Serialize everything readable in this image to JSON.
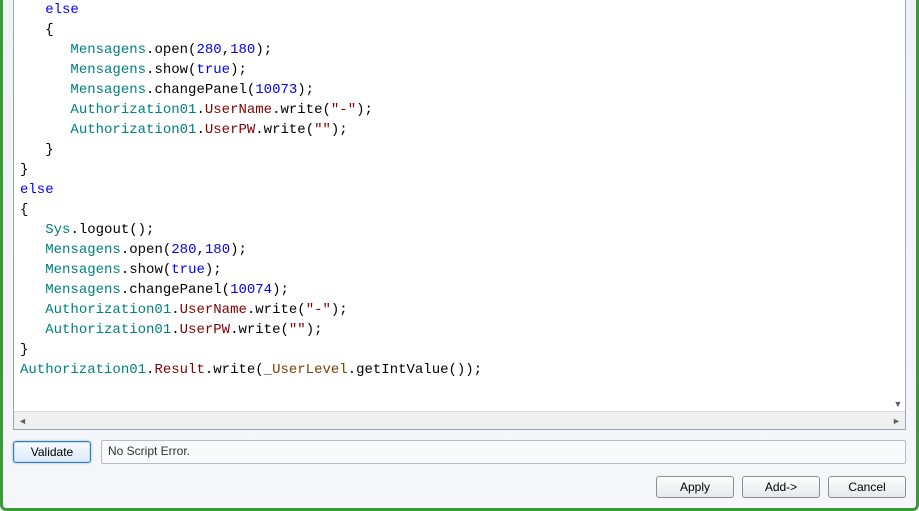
{
  "code": {
    "l01_kw": "else",
    "l02_pun": "{",
    "l03_a": "Mensagens",
    "l03_b": ".open(",
    "l03_c": "280",
    "l03_d": ",",
    "l03_e": "180",
    "l03_f": ");",
    "l04_a": "Mensagens",
    "l04_b": ".show(",
    "l04_c": "true",
    "l04_d": ");",
    "l05_a": "Mensagens",
    "l05_b": ".changePanel(",
    "l05_c": "10073",
    "l05_d": ");",
    "l06_a": "Authorization01",
    "l06_b": ".",
    "l06_c": "UserName",
    "l06_d": ".write(",
    "l06_e": "\"-\"",
    "l06_f": ");",
    "l07_a": "Authorization01",
    "l07_b": ".",
    "l07_c": "UserPW",
    "l07_d": ".write(",
    "l07_e": "\"\"",
    "l07_f": ");",
    "l08_pun": "}",
    "l09_pun": "}",
    "l10_kw": "else",
    "l11_pun": "{",
    "l12_a": "Sys",
    "l12_b": ".logout();",
    "l13_a": "Mensagens",
    "l13_b": ".open(",
    "l13_c": "280",
    "l13_d": ",",
    "l13_e": "180",
    "l13_f": ");",
    "l14_a": "Mensagens",
    "l14_b": ".show(",
    "l14_c": "true",
    "l14_d": ");",
    "l15_a": "Mensagens",
    "l15_b": ".changePanel(",
    "l15_c": "10074",
    "l15_d": ");",
    "l16_a": "Authorization01",
    "l16_b": ".",
    "l16_c": "UserName",
    "l16_d": ".write(",
    "l16_e": "\"-\"",
    "l16_f": ");",
    "l17_a": "Authorization01",
    "l17_b": ".",
    "l17_c": "UserPW",
    "l17_d": ".write(",
    "l17_e": "\"\"",
    "l17_f": ");",
    "l18_pun": "}",
    "l19_a": "Authorization01",
    "l19_b": ".",
    "l19_c": "Result",
    "l19_d": ".write(",
    "l19_e": "_UserLevel",
    "l19_f": ".getIntValue());"
  },
  "status": "No Script Error.",
  "buttons": {
    "validate": "Validate",
    "apply": "Apply",
    "add": "Add->",
    "cancel": "Cancel"
  },
  "scroll": {
    "left_arrow": "◄",
    "right_arrow": "►",
    "down_arrow": "▼"
  }
}
